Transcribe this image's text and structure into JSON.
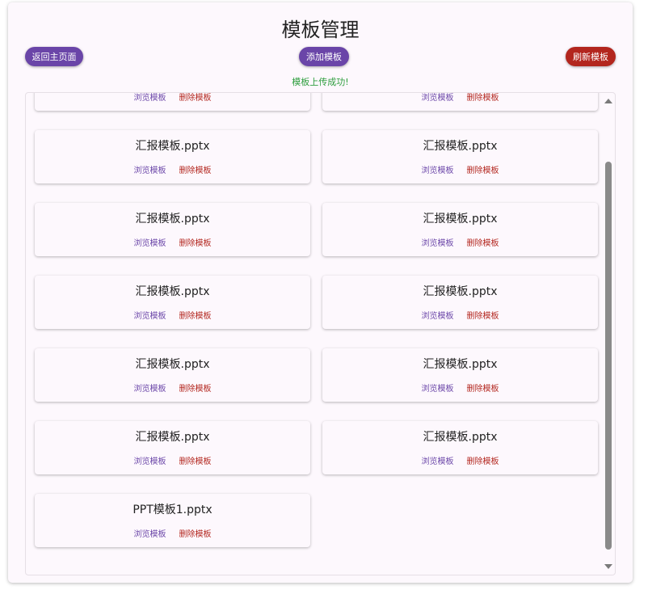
{
  "header": {
    "title": "模板管理",
    "back_label": "返回主页面",
    "add_label": "添加模板",
    "refresh_label": "刷新模板"
  },
  "status_message": "模板上传成功!",
  "actions": {
    "view_label": "浏览模板",
    "delete_label": "删除模板"
  },
  "templates": [
    "",
    "",
    "汇报模板.pptx",
    "汇报模板.pptx",
    "汇报模板.pptx",
    "汇报模板.pptx",
    "汇报模板.pptx",
    "汇报模板.pptx",
    "汇报模板.pptx",
    "汇报模板.pptx",
    "汇报模板.pptx",
    "汇报模板.pptx",
    "PPT模板1.pptx"
  ],
  "colors": {
    "primary": "#6a45a8",
    "danger": "#b3261e",
    "success": "#2e9e3e"
  }
}
